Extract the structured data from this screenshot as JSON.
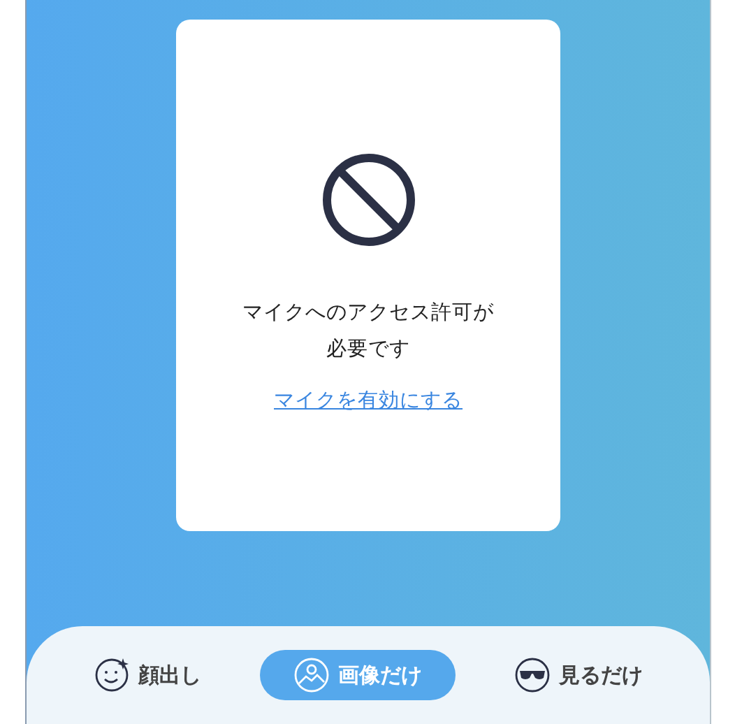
{
  "notice": {
    "message": "マイクへのアクセス許可が必要です",
    "link": "マイクを有効にする"
  },
  "modes": [
    {
      "kind": "face",
      "label": "顔出し",
      "selected": false
    },
    {
      "kind": "image",
      "label": "画像だけ",
      "selected": true
    },
    {
      "kind": "glasses",
      "label": "見るだけ",
      "selected": false
    }
  ]
}
